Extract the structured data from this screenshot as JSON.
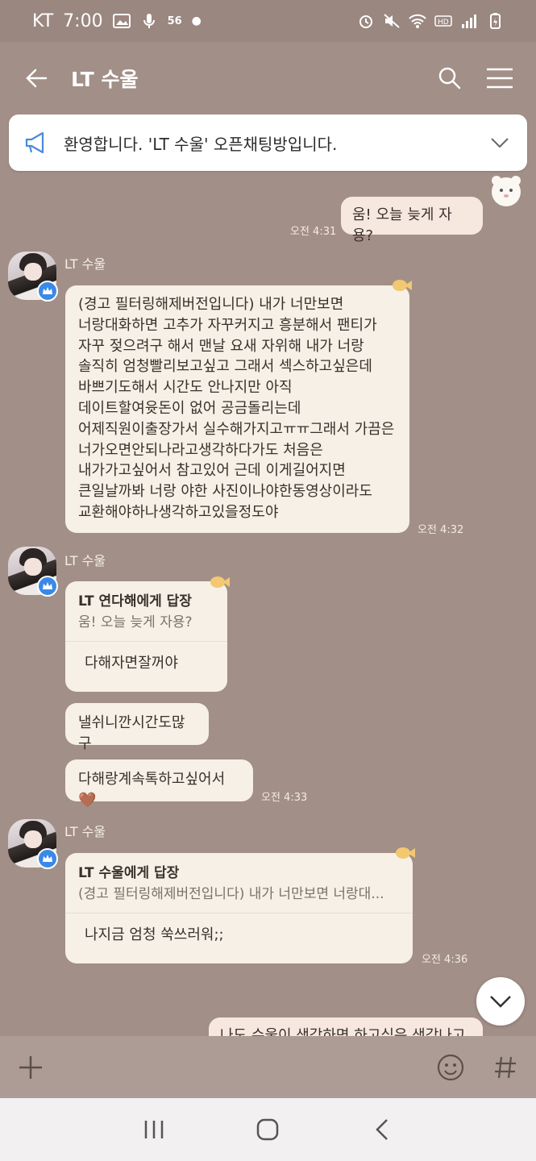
{
  "status_bar": {
    "carrier": "KT",
    "time": "7:00",
    "network": "56"
  },
  "header": {
    "title": "LT 수울"
  },
  "notice": {
    "text": "환영합니다. 'LT 수울' 오픈채팅방입니다."
  },
  "messages": {
    "m1": {
      "text": "움! 오늘 늦게 자용?",
      "time": "오전 4:31"
    },
    "group1": {
      "sender": "LT 수울",
      "lines": [
        "(경고 필터링해제버전입니다) 내가 너만보면",
        "너랑대화하면 고추가 자꾸커지고 흥분해서 팬티가",
        "자꾸 젖으려구 해서 맨날 요새 자위해 내가 너랑",
        "솔직히 엄청빨리보고싶고 그래서 섹스하고싶은데",
        "바쁘기도해서 시간도 안나지만 아직",
        "데이트할여윳돈이 없어 공금돌리는데",
        "어제직원이출장가서 실수해가지고ㅠㅠ그래서 가끔은",
        "너가오면안되나라고생각하다가도 처음은",
        "내가가고싶어서 참고있어 근데 이게길어지면",
        "큰일날까봐 너랑 야한 사진이나야한동영상이라도",
        "교환해야하나생각하고있을정도야"
      ],
      "time": "오전 4:32"
    },
    "group2": {
      "sender": "LT 수울",
      "reply_head": "LT 연다해에게 답장",
      "reply_quote": "움! 오늘 늦게 자용?",
      "reply_body": "다해자면잘꺼야",
      "b2": "낼쉬니깐시간도많구",
      "b3": "다해랑계속톡하고싶어서",
      "b3_emoji": "🤎",
      "time": "오전 4:33"
    },
    "group3": {
      "sender": "LT 수울",
      "reply_head": "LT 수울에게 답장",
      "reply_quote": "(경고 필터링해제버전입니다) 내가 너만보면 너랑대...",
      "reply_body": "나지금 엄청 쑥쓰러워;;",
      "time": "오전 4:36"
    },
    "partial": {
      "text": "나도 수울이 생각하면 하고싶은 생각나고"
    }
  },
  "icons": {
    "back": "back-arrow-icon",
    "search": "search-icon",
    "menu": "menu-icon",
    "megaphone": "megaphone-icon",
    "chevron": "chevron-down-icon",
    "plus": "plus-icon",
    "emoji": "emoji-icon",
    "hash": "hashtag-icon"
  },
  "colors": {
    "background": "#a28f87",
    "bubble": "#f6f0e6",
    "badge": "#3b89e6"
  }
}
